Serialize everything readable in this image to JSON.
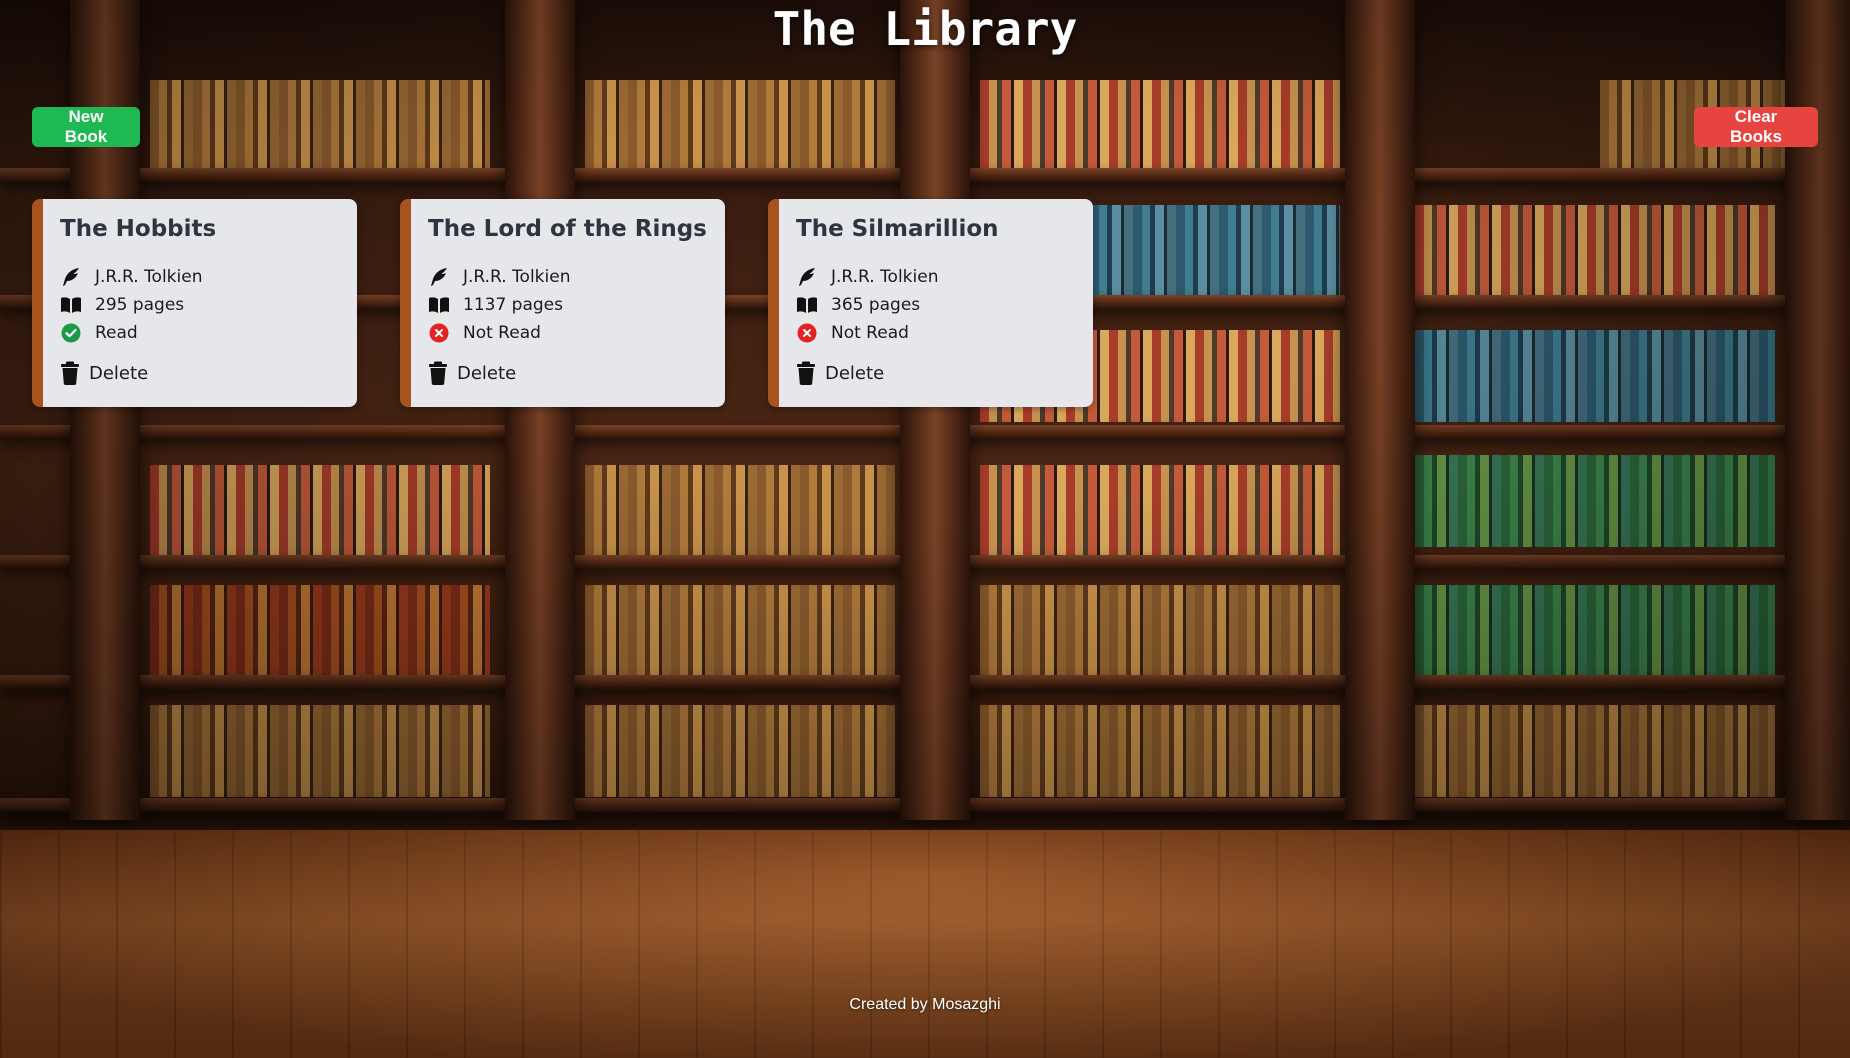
{
  "app": {
    "title": "The Library",
    "footer": "Created by Mosazghi"
  },
  "toolbar": {
    "new_book_label": "New Book",
    "clear_books_label": "Clear Books"
  },
  "books": [
    {
      "title": "The Hobbits",
      "author": "J.R.R. Tolkien",
      "pages": "295 pages",
      "status": "Read",
      "read": true,
      "delete_label": "Delete"
    },
    {
      "title": "The Lord of the Rings",
      "author": "J.R.R. Tolkien",
      "pages": "1137 pages",
      "status": "Not Read",
      "read": false,
      "delete_label": "Delete"
    },
    {
      "title": "The Silmarillion",
      "author": "J.R.R. Tolkien",
      "pages": "365 pages",
      "status": "Not Read",
      "read": false,
      "delete_label": "Delete"
    }
  ],
  "colors": {
    "new_button": "#1fb954",
    "clear_button": "#e8443f",
    "card_accent": "#a8521f",
    "read_icon": "#1a9a46",
    "not_read_icon": "#e52222"
  },
  "icons": {
    "author": "quill-icon",
    "pages": "open-book-icon",
    "read": "check-circle-icon",
    "not_read": "x-circle-icon",
    "delete": "trash-icon"
  }
}
